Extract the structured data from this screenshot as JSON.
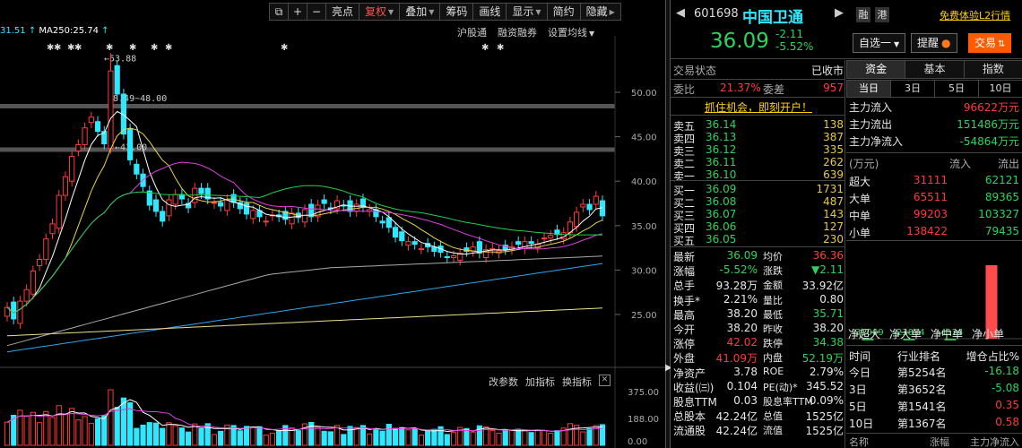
{
  "toolbar": {
    "items": [
      "亮点",
      "复权",
      "叠加",
      "筹码",
      "画线",
      "显示",
      "简约",
      "隐藏"
    ],
    "active": "复权",
    "icon_labels": [
      "⧉",
      "+",
      "−"
    ]
  },
  "ma_line": {
    "prefix": "31.51",
    "ma250": "MA250:25.74"
  },
  "chart_links": [
    "沪股通",
    "融资融券",
    "设置均线"
  ],
  "price_axis": {
    "ticks": [
      "50.00",
      "45.00",
      "40.00",
      "35.00",
      "30.00",
      "25.00"
    ],
    "marks": [
      "←53.88",
      "48.49~48.00",
      "←43.00"
    ]
  },
  "volume_axis": {
    "ticks": [
      "375.00",
      "188.00",
      "0.00"
    ],
    "tools": [
      "改参数",
      "加指标",
      "换指标"
    ],
    "close": "✕"
  },
  "colors": {
    "up": "#ff3b3b",
    "down": "#2ee8ff",
    "ma5": "#ffffff",
    "ma10": "#e8d44a",
    "ma20": "#e23ce0",
    "ma60": "#22d04a",
    "ma120": "#aaaaaa",
    "ma250_cyan": "#2ea5e8",
    "ma_yellow": "#e8e08a",
    "accent": "#ff5a00"
  },
  "quote": {
    "code": "601698",
    "name": "中国卫通",
    "badges": [
      "融",
      "港"
    ],
    "trial_link": "免费体验L2行情",
    "price": "36.09",
    "change": "-2.11",
    "change_pct": "-5.52%",
    "buttons": [
      "自选一",
      "提醒",
      "交易"
    ],
    "status_label": "交易状态",
    "status_value": "已收市",
    "weibi_label": "委比",
    "weibi_value": "21.37%",
    "weicha_label": "委差",
    "weicha_value": "957",
    "promo": "抓住机会，即刻开户！",
    "asks": [
      {
        "label": "卖五",
        "price": "36.14",
        "vol": "138"
      },
      {
        "label": "卖四",
        "price": "36.13",
        "vol": "387"
      },
      {
        "label": "卖三",
        "price": "36.12",
        "vol": "335"
      },
      {
        "label": "卖二",
        "price": "36.11",
        "vol": "262"
      },
      {
        "label": "卖一",
        "price": "36.10",
        "vol": "639"
      }
    ],
    "bids": [
      {
        "label": "买一",
        "price": "36.09",
        "vol": "1731"
      },
      {
        "label": "买二",
        "price": "36.08",
        "vol": "487"
      },
      {
        "label": "买三",
        "price": "36.07",
        "vol": "143"
      },
      {
        "label": "买四",
        "price": "36.06",
        "vol": "127"
      },
      {
        "label": "买五",
        "price": "36.05",
        "vol": "230"
      }
    ],
    "stats": [
      {
        "l1": "最新",
        "v1": "36.09",
        "c1": "green",
        "l2": "均价",
        "v2": "36.36",
        "c2": "red"
      },
      {
        "l1": "涨幅",
        "v1": "-5.52%",
        "c1": "green",
        "l2": "涨跌",
        "v2": "▼2.11",
        "c2": "green"
      },
      {
        "l1": "总手",
        "v1": "93.28万",
        "c1": "white",
        "l2": "金额",
        "v2": "33.92亿",
        "c2": "white"
      },
      {
        "l1": "换手*",
        "v1": "2.21%",
        "c1": "white",
        "l2": "量比",
        "v2": "0.80",
        "c2": "white"
      },
      {
        "l1": "最高",
        "v1": "38.20",
        "c1": "white",
        "l2": "最低",
        "v2": "35.71",
        "c2": "green"
      },
      {
        "l1": "今开",
        "v1": "38.20",
        "c1": "white",
        "l2": "昨收",
        "v2": "38.20",
        "c2": "white"
      },
      {
        "l1": "涨停",
        "v1": "42.02",
        "c1": "red",
        "l2": "跌停",
        "v2": "34.38",
        "c2": "green"
      },
      {
        "l1": "外盘",
        "v1": "41.09万",
        "c1": "red",
        "l2": "内盘",
        "v2": "52.19万",
        "c2": "green"
      },
      {
        "l1": "净资产",
        "v1": "3.78",
        "c1": "white",
        "l2": "ROE",
        "v2": "2.79%",
        "c2": "white"
      },
      {
        "l1": "收益(㈢)",
        "v1": "0.104",
        "c1": "white",
        "l2": "PE(动)*",
        "v2": "345.52",
        "c2": "white"
      },
      {
        "l1": "股息TTM",
        "v1": "0.03",
        "c1": "white",
        "l2": "股息率TTM",
        "v2": "0.09%",
        "c2": "white"
      },
      {
        "l1": "总股本",
        "v1": "42.24亿",
        "c1": "white",
        "l2": "总值",
        "v2": "1525亿",
        "c2": "white"
      },
      {
        "l1": "流通股",
        "v1": "42.24亿",
        "c1": "white",
        "l2": "流值",
        "v2": "1525亿",
        "c2": "white"
      }
    ]
  },
  "capital_flow": {
    "tabs": [
      "资金",
      "基本",
      "指数"
    ],
    "active_tab": "资金",
    "periods": [
      "当日",
      "3日",
      "5日",
      "10日"
    ],
    "active_period": "当日",
    "inflow": [
      {
        "label": "主力流入",
        "value": "96622万元",
        "color": "red"
      },
      {
        "label": "主力流出",
        "value": "151486万元",
        "color": "green"
      },
      {
        "label": "主力净流入",
        "value": "-54864万元",
        "color": "green"
      }
    ],
    "table_header": {
      "unit": "(万元)",
      "in": "流入",
      "out": "流出"
    },
    "table": [
      {
        "label": "超大",
        "in": "31111",
        "out": "62121"
      },
      {
        "label": "大单",
        "in": "65511",
        "out": "89365"
      },
      {
        "label": "中单",
        "in": "99203",
        "out": "103327"
      },
      {
        "label": "小单",
        "in": "138422",
        "out": "79435"
      }
    ],
    "net_bars": [
      {
        "label": "净超大",
        "value": -31009,
        "text": "-31009"
      },
      {
        "label": "净大单",
        "value": -23854,
        "text": "-23854"
      },
      {
        "label": "净中单",
        "value": -4124,
        "text": "-4124"
      },
      {
        "label": "净小单",
        "value": 58987,
        "text": "58987"
      }
    ],
    "ranking_header": {
      "time": "时间",
      "rank": "行业排名",
      "ratio": "增仓占比%"
    },
    "ranking": [
      {
        "time": "今日",
        "rank": "第5254名",
        "ratio": "-16.18",
        "color": "green"
      },
      {
        "time": "3日",
        "rank": "第3652名",
        "ratio": "-5.08",
        "color": "green"
      },
      {
        "time": "5日",
        "rank": "第1541名",
        "ratio": "0.35",
        "color": "red"
      },
      {
        "time": "10日",
        "rank": "第1367名",
        "ratio": "0.58",
        "color": "red"
      }
    ],
    "footer": [
      "名称",
      "涨幅",
      "主力净流入"
    ]
  }
}
